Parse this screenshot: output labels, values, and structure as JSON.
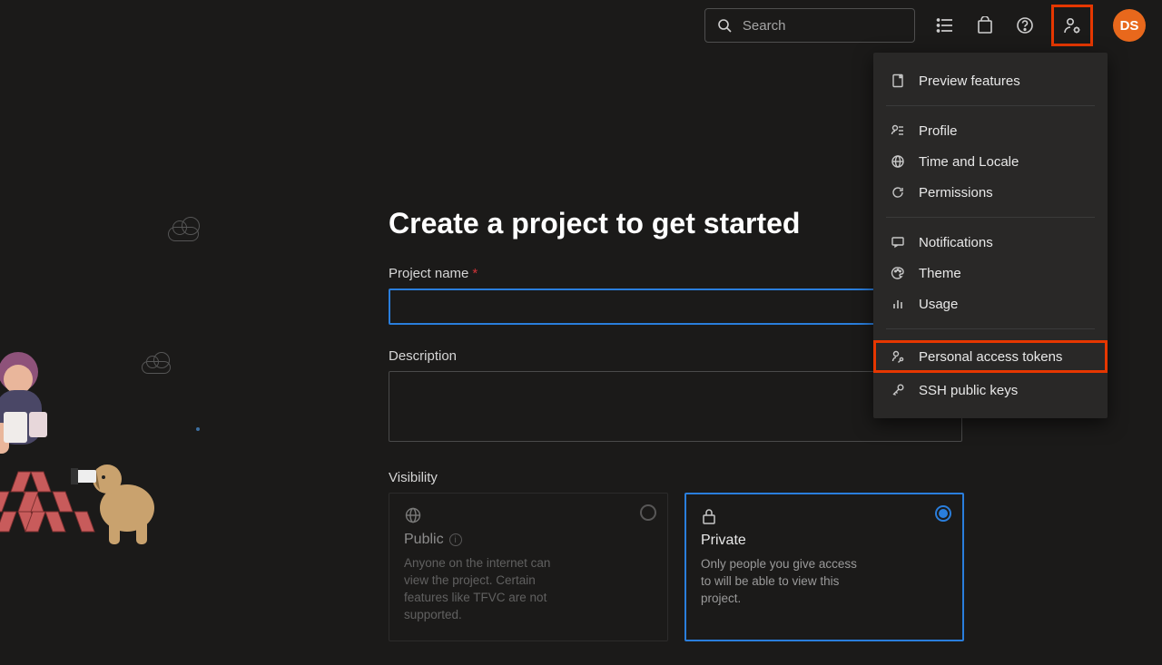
{
  "search": {
    "placeholder": "Search"
  },
  "avatar_initials": "DS",
  "user_menu": {
    "preview_features": "Preview features",
    "profile": "Profile",
    "time_locale": "Time and Locale",
    "permissions": "Permissions",
    "notifications": "Notifications",
    "theme": "Theme",
    "usage": "Usage",
    "pat": "Personal access tokens",
    "ssh": "SSH public keys"
  },
  "form": {
    "heading": "Create a project to get started",
    "name_label": "Project name",
    "name_value": "",
    "desc_label": "Description",
    "desc_value": "",
    "visibility_label": "Visibility",
    "public": {
      "title": "Public",
      "desc": "Anyone on the internet can view the project. Certain features like TFVC are not supported."
    },
    "private": {
      "title": "Private",
      "desc": "Only people you give access to will be able to view this project."
    }
  },
  "highlights": {
    "user_settings_icon": true,
    "pat_menu_item": true
  }
}
